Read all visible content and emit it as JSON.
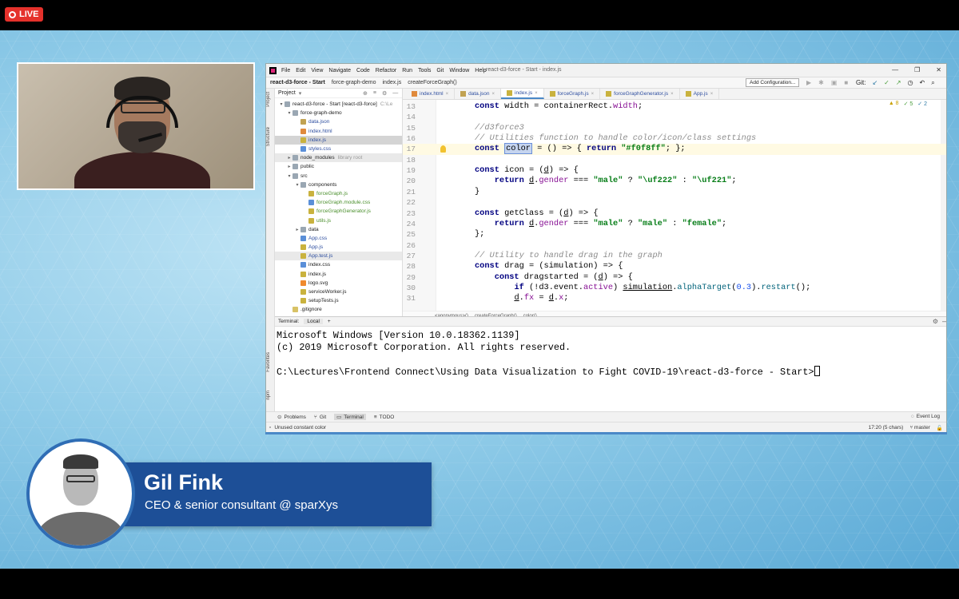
{
  "live_badge": "LIVE",
  "ide": {
    "menu": [
      "File",
      "Edit",
      "View",
      "Navigate",
      "Code",
      "Refactor",
      "Run",
      "Tools",
      "Git",
      "Window",
      "Help"
    ],
    "window_title": "react-d3-force - Start - index.js",
    "breadcrumbs": [
      "react-d3-force - Start",
      "force-graph-demo",
      "index.js",
      "createForceGraph()"
    ],
    "add_config": "Add Configuration...",
    "git_label": "Git:",
    "project_header": "Project",
    "side_labels": [
      "Project",
      "Structure",
      "Favorites",
      "npm"
    ],
    "tree": [
      {
        "indent": 0,
        "arrow": "▾",
        "icon": "folder",
        "label": "react-d3-force - Start [react-d3-force]",
        "extra": "C:\\Le",
        "cls": ""
      },
      {
        "indent": 1,
        "arrow": "▾",
        "icon": "folder",
        "label": "force-graph-demo",
        "extra": "",
        "cls": ""
      },
      {
        "indent": 2,
        "arrow": "",
        "icon": "fjson",
        "label": "data.json",
        "extra": "",
        "cls": "b"
      },
      {
        "indent": 2,
        "arrow": "",
        "icon": "fhtml",
        "label": "index.html",
        "extra": "",
        "cls": "b"
      },
      {
        "indent": 2,
        "arrow": "",
        "icon": "fjs",
        "label": "index.js",
        "extra": "",
        "cls": "b",
        "sel": true
      },
      {
        "indent": 2,
        "arrow": "",
        "icon": "fcss",
        "label": "styles.css",
        "extra": "",
        "cls": "b"
      },
      {
        "indent": 1,
        "arrow": "▸",
        "icon": "folder",
        "label": "node_modules",
        "extra": "library root",
        "cls": "hl"
      },
      {
        "indent": 1,
        "arrow": "▸",
        "icon": "folder",
        "label": "public",
        "extra": "",
        "cls": ""
      },
      {
        "indent": 1,
        "arrow": "▾",
        "icon": "folder",
        "label": "src",
        "extra": "",
        "cls": ""
      },
      {
        "indent": 2,
        "arrow": "▾",
        "icon": "folder",
        "label": "components",
        "extra": "",
        "cls": ""
      },
      {
        "indent": 3,
        "arrow": "",
        "icon": "fjs",
        "label": "forceGraph.js",
        "extra": "",
        "cls": "g"
      },
      {
        "indent": 3,
        "arrow": "",
        "icon": "fcss",
        "label": "forceGraph.module.css",
        "extra": "",
        "cls": "g"
      },
      {
        "indent": 3,
        "arrow": "",
        "icon": "fjs",
        "label": "forceGraphGenerator.js",
        "extra": "",
        "cls": "g"
      },
      {
        "indent": 3,
        "arrow": "",
        "icon": "fjs",
        "label": "utils.js",
        "extra": "",
        "cls": "g"
      },
      {
        "indent": 2,
        "arrow": "▸",
        "icon": "folder",
        "label": "data",
        "extra": "",
        "cls": ""
      },
      {
        "indent": 2,
        "arrow": "",
        "icon": "fcss",
        "label": "App.css",
        "extra": "",
        "cls": "b"
      },
      {
        "indent": 2,
        "arrow": "",
        "icon": "fjs",
        "label": "App.js",
        "extra": "",
        "cls": "b"
      },
      {
        "indent": 2,
        "arrow": "",
        "icon": "fjs",
        "label": "App.test.js",
        "extra": "",
        "cls": "b",
        "hl": true
      },
      {
        "indent": 2,
        "arrow": "",
        "icon": "fcss",
        "label": "index.css",
        "extra": "",
        "cls": ""
      },
      {
        "indent": 2,
        "arrow": "",
        "icon": "fjs",
        "label": "index.js",
        "extra": "",
        "cls": ""
      },
      {
        "indent": 2,
        "arrow": "",
        "icon": "fsvg",
        "label": "logo.svg",
        "extra": "",
        "cls": ""
      },
      {
        "indent": 2,
        "arrow": "",
        "icon": "fjs",
        "label": "serviceWorker.js",
        "extra": "",
        "cls": ""
      },
      {
        "indent": 2,
        "arrow": "",
        "icon": "fjs",
        "label": "setupTests.js",
        "extra": "",
        "cls": ""
      },
      {
        "indent": 1,
        "arrow": "",
        "icon": "file",
        "label": ".gitignore",
        "extra": "",
        "cls": ""
      }
    ],
    "tabs": [
      {
        "label": "index.html",
        "icon": "htmlic"
      },
      {
        "label": "data.json",
        "icon": "jsonic"
      },
      {
        "label": "index.js",
        "icon": "jsic",
        "active": true
      },
      {
        "label": "forceGraph.js",
        "icon": "jsic"
      },
      {
        "label": "forceGraphGenerator.js",
        "icon": "jsic"
      },
      {
        "label": "App.js",
        "icon": "jsic"
      }
    ],
    "inspections": {
      "warnings": "▲ 8",
      "ok": "✓ 5",
      "info": "✓ 2"
    },
    "code_lines": [
      {
        "n": "13",
        "html": "<span class=\"kw\">const</span> width = containerRect.<span class=\"pr\">width</span>;"
      },
      {
        "n": "14",
        "html": ""
      },
      {
        "n": "15",
        "html": "<span class=\"cm\">//d3force3</span>"
      },
      {
        "n": "16",
        "html": "<span class=\"cm\">// Utilities function to handle color/icon/class settings</span>"
      },
      {
        "n": "17",
        "html": "<span class=\"kw\">const</span> <span class=\"selw\">color</span> = () => { <span class=\"kw\">return</span> <span class=\"str\">\"#f0f8ff\"</span>; };",
        "cur": true
      },
      {
        "n": "18",
        "html": ""
      },
      {
        "n": "19",
        "html": "<span class=\"kw\">const</span> icon = (<span class=\"ul\">d</span>) => {"
      },
      {
        "n": "20",
        "html": "    <span class=\"kw\">return</span> <span class=\"ul\">d</span>.<span class=\"pr\">gender</span> === <span class=\"str\">\"male\"</span> ? <span class=\"str\">\"\\uf222\"</span> : <span class=\"str\">\"\\uf221\"</span>;"
      },
      {
        "n": "21",
        "html": "}"
      },
      {
        "n": "22",
        "html": ""
      },
      {
        "n": "23",
        "html": "<span class=\"kw\">const</span> getClass = (<span class=\"ul\">d</span>) => {"
      },
      {
        "n": "24",
        "html": "    <span class=\"kw\">return</span> <span class=\"ul\">d</span>.<span class=\"pr\">gender</span> === <span class=\"str\">\"male\"</span> ? <span class=\"str\">\"male\"</span> : <span class=\"str\">\"female\"</span>;"
      },
      {
        "n": "25",
        "html": "};"
      },
      {
        "n": "26",
        "html": ""
      },
      {
        "n": "27",
        "html": "<span class=\"cm\">// Utility to handle drag in the graph</span>"
      },
      {
        "n": "28",
        "html": "<span class=\"kw\">const</span> drag = (simulation) => {"
      },
      {
        "n": "29",
        "html": "    <span class=\"kw\">const</span> dragstarted = (<span class=\"ul\">d</span>) => {"
      },
      {
        "n": "30",
        "html": "        <span class=\"kw\">if</span> (!d3.event.<span class=\"pr\">active</span>) <span class=\"ul\">simulation</span>.<span class=\"fn\">alphaTarget</span>(<span class=\"num\">0.3</span>).<span class=\"fn\">restart</span>();"
      },
      {
        "n": "31",
        "html": "        <span class=\"ul\">d</span>.<span class=\"pr\">fx</span> = <span class=\"ul\">d</span>.<span class=\"pr\">x</span>;"
      }
    ],
    "code_crumbs": [
      "<anonymous>()",
      "createForceGraph()",
      "color()"
    ],
    "terminal_title": "Terminal:",
    "terminal_tab": "Local",
    "terminal_add": "+",
    "terminal_lines": [
      "Microsoft Windows [Version 10.0.18362.1139]",
      "(c) 2019 Microsoft Corporation. All rights reserved.",
      "",
      "C:\\Lectures\\Frontend Connect\\Using Data Visualization to Fight COVID-19\\react-d3-force - Start>"
    ],
    "tool_windows": [
      "Problems",
      "Git",
      "Terminal",
      "TODO"
    ],
    "event_log": "Event Log",
    "status_msg": "Unused constant color",
    "status_pos": "17:20 (5 chars)",
    "status_branch": "master"
  },
  "lower_third": {
    "name": "Gil Fink",
    "role": "CEO & senior consultant @ sparXys"
  }
}
